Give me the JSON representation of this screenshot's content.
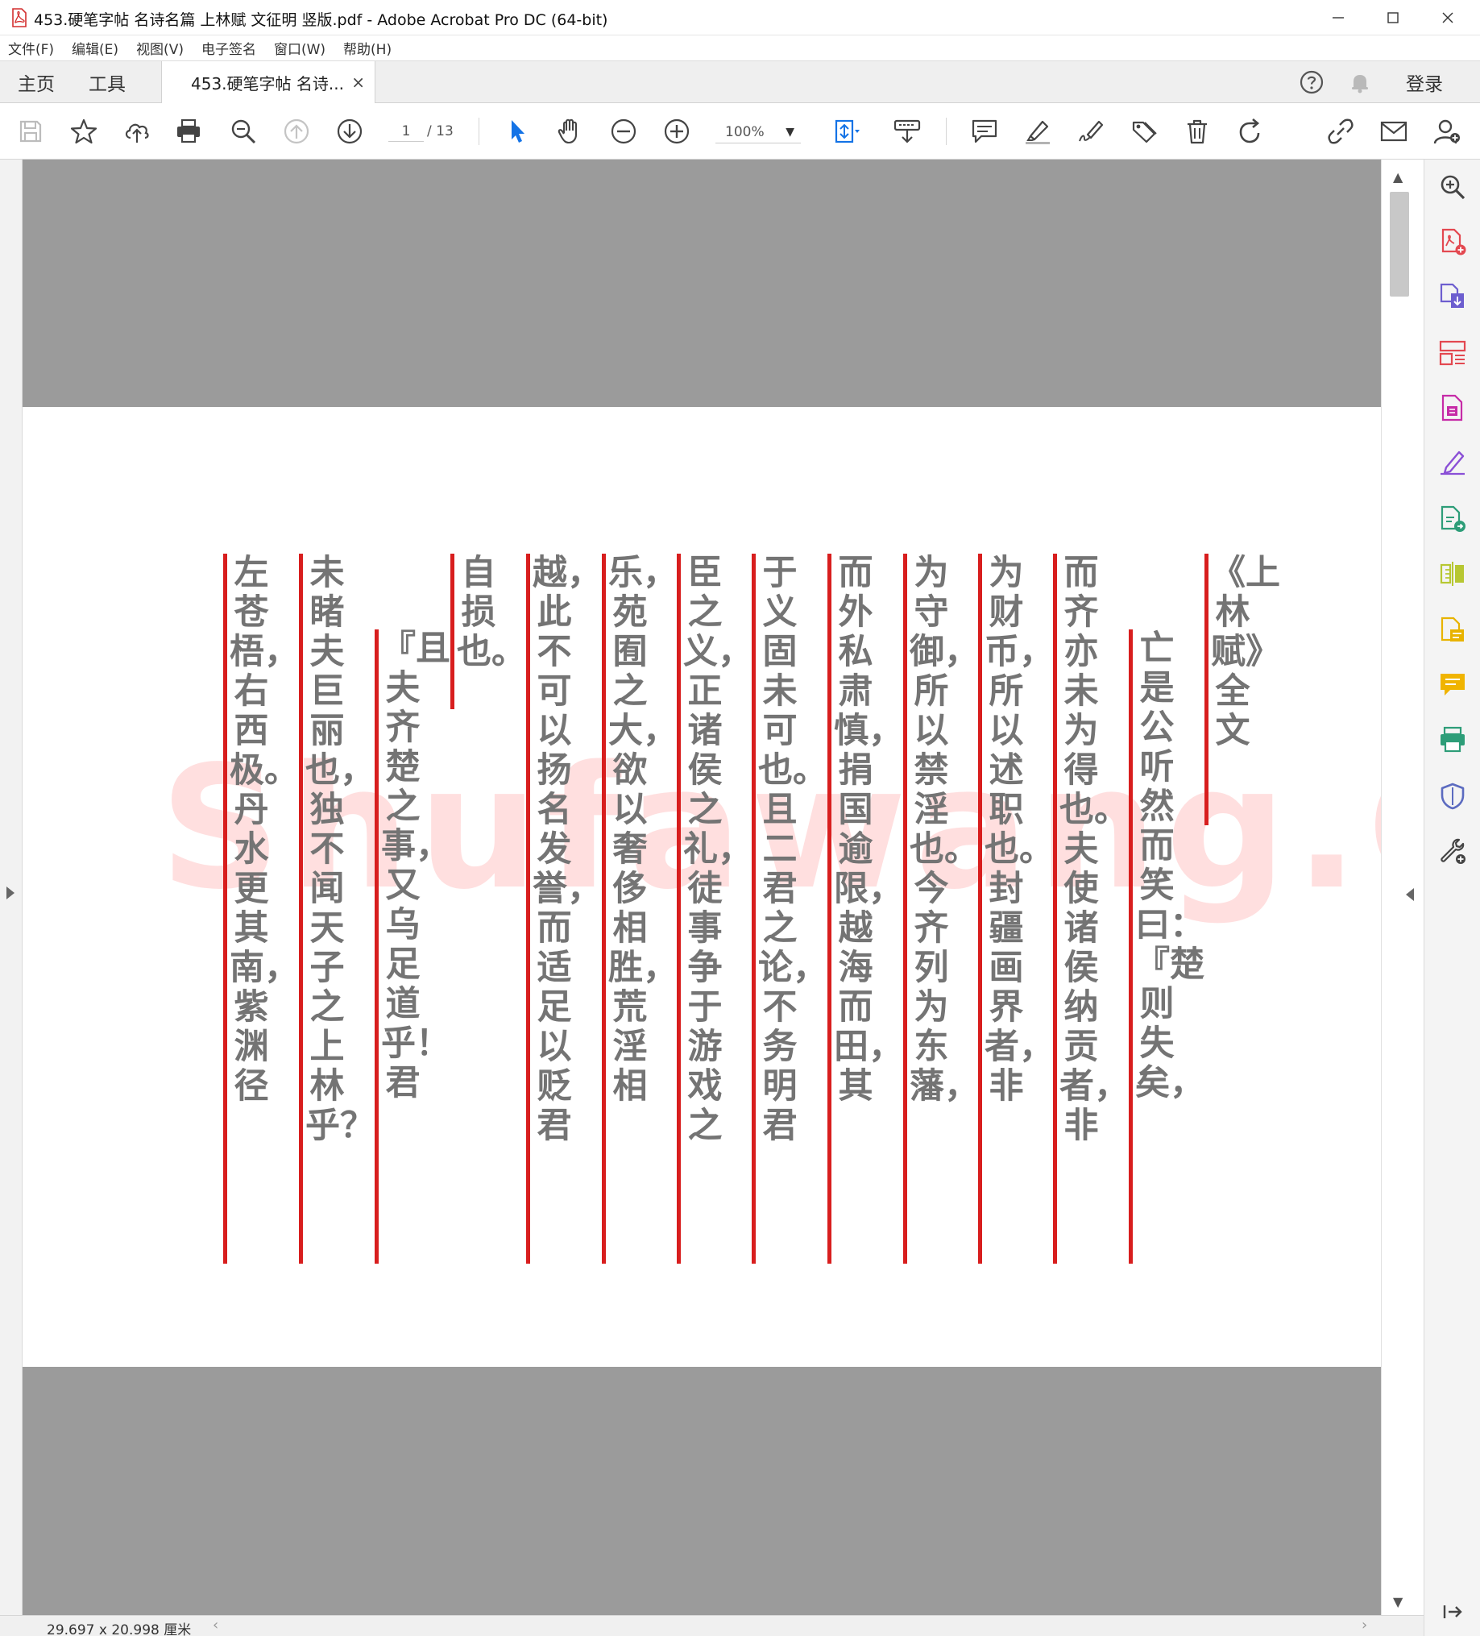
{
  "window": {
    "title": "453.硬笔字帖 名诗名篇 上林赋 文征明 竖版.pdf - Adobe Acrobat Pro DC (64-bit)"
  },
  "menu": [
    "文件(F)",
    "编辑(E)",
    "视图(V)",
    "电子签名",
    "窗口(W)",
    "帮助(H)"
  ],
  "tabs": {
    "home": "主页",
    "tools": "工具",
    "document": "453.硬笔字帖 名诗...",
    "close_glyph": "×"
  },
  "header": {
    "login": "登录"
  },
  "toolbar": {
    "page_current": "1",
    "page_total": "/ 13",
    "zoom": "100%",
    "zoom_caret": "▼"
  },
  "document": {
    "watermark": "Shufawang.CN",
    "columns": [
      "《上林赋》全文",
      "亡是公听然而笑曰：『楚则失矣，",
      "而齐亦未为得也。夫使诸侯纳贡者，非",
      "为财币，所以述职也。封疆画界者，非",
      "为守御，所以禁淫也。今齐列为东藩，",
      "而外私肃慎，捐国逾限，越海而田，其",
      "于义固未可也。且二君之论，不务明君",
      "臣之义，正诸侯之礼，徒事争于游戏之",
      "乐，苑囿之大，欲以奢侈相胜，荒淫相",
      "越，此不可以扬名发誉，而适足以贬君",
      "自损也。",
      "『且夫齐楚之事，又乌足道乎！君",
      "未睹夫巨丽也，独不闻天子之上林乎？",
      "左苍梧，右西极。丹水更其南，紫渊径"
    ]
  },
  "status": {
    "dimensions": "29.697 x 20.998 厘米",
    "scroll_left": "‹",
    "scroll_right": "›"
  },
  "colors": {
    "accent_blue": "#1473e6",
    "guide_line_red": "#d81e1e",
    "text_gray": "#747474",
    "page_gutter_gray": "#9b9b9b"
  }
}
